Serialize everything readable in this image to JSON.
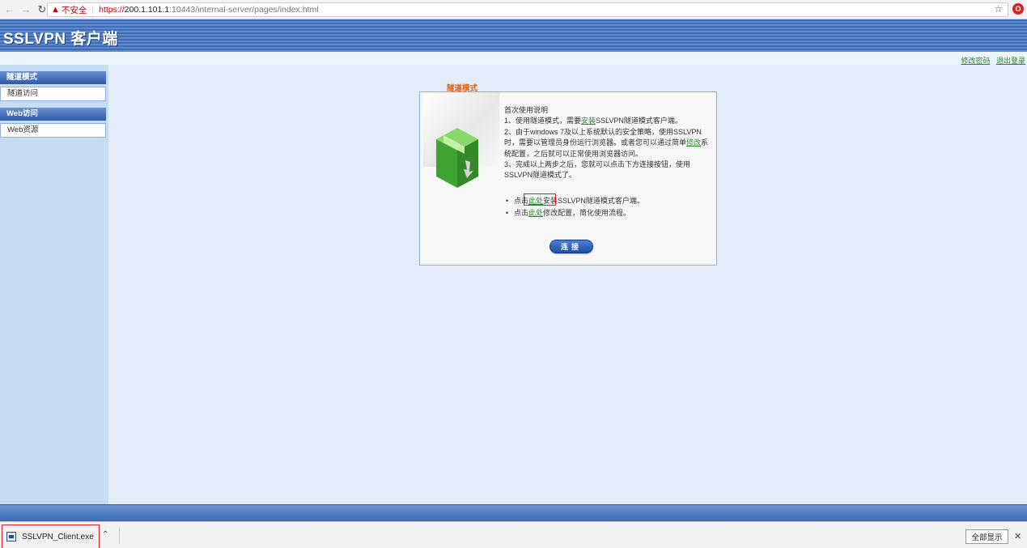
{
  "browser": {
    "insecure_label": "不安全",
    "url_scheme": "https://",
    "url_host": "200.1.101.1",
    "url_path": ":10443/internal-server/pages/index.html"
  },
  "header": {
    "app_title": "SSLVPN 客户端",
    "links": [
      "修改密码",
      "退出登录"
    ]
  },
  "sidebar": {
    "sections": [
      {
        "title": "隧道模式",
        "item": "隧道访问"
      },
      {
        "title": "Web访问",
        "item": "Web资源"
      }
    ]
  },
  "panel": {
    "title": "隧道模式",
    "heading": "首次使用说明",
    "line1_prefix": "1、使用隧道模式，需要",
    "line1_link": "安装",
    "line1_suffix": "SSLVPN隧道模式客户端。",
    "line2_prefix": "2、由于windows 7及以上系统默认的安全策略，使用SSLVPN时，需要以管理员身份运行浏览器。或者您可以通过简单",
    "line2_link": "修改",
    "line2_suffix": "系统配置，之后就可以正常使用浏览器访问。",
    "line3": "3、完成以上两步之后，您就可以点击下方连接按钮，使用SSLVPN隧道模式了。",
    "bullet1_prefix": "点击",
    "bullet1_link": "此处",
    "bullet1_suffix": "安装SSLVPN隧道模式客户端。",
    "bullet2_prefix": "点击",
    "bullet2_link": "此处",
    "bullet2_suffix": "修改配置，简化使用流程。",
    "connect_label": "连接"
  },
  "downloads": {
    "filename": "SSLVPN_Client.exe",
    "show_all": "全部显示"
  },
  "colors": {
    "banner": "#3f6cb6",
    "accent_orange": "#e85d0a",
    "link_green": "#2a8a2a",
    "highlight_red": "#d9232d"
  }
}
